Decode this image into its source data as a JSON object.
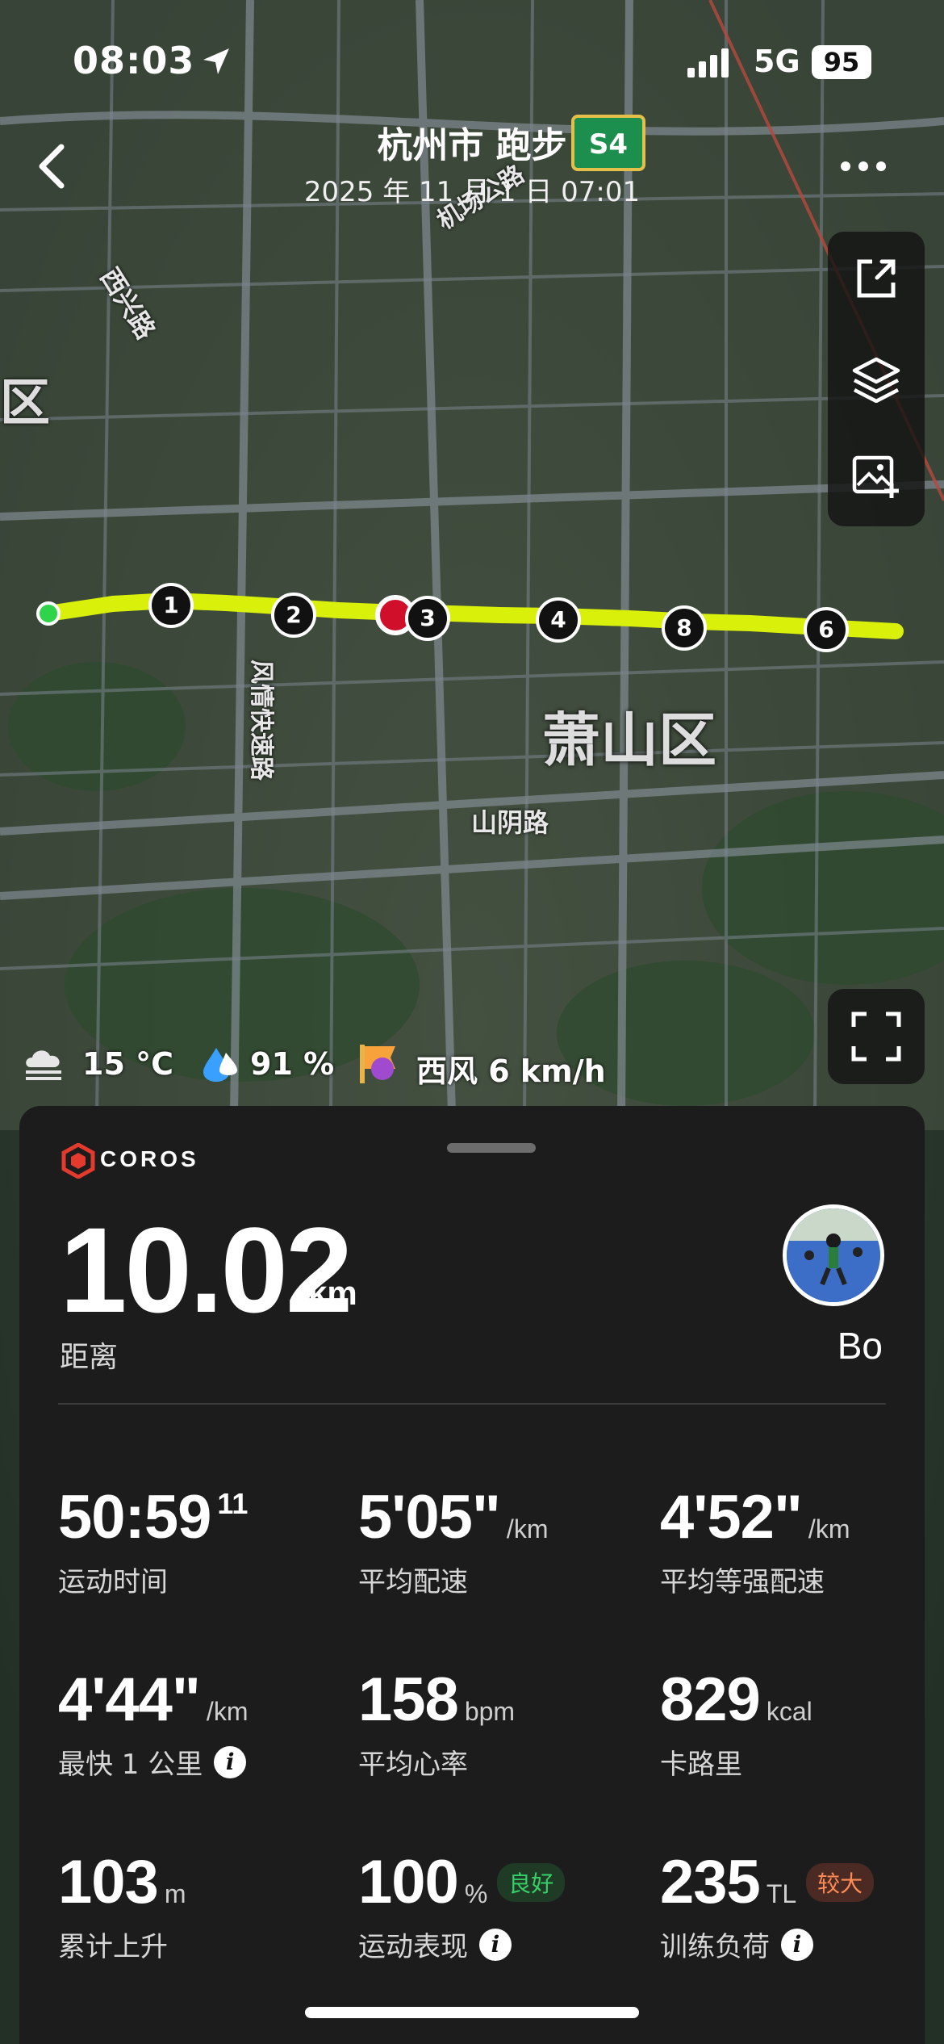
{
  "status_bar": {
    "time": "08:03",
    "network": "5G",
    "battery": "95"
  },
  "header": {
    "title": "杭州市 跑步",
    "subtitle": "2025 年 11 月 1 日 07:01"
  },
  "map": {
    "labels": {
      "district": "萧山区",
      "road_1": "西兴路",
      "road_2": "风情快速路",
      "road_3": "山阴路",
      "road_4": "机场公路",
      "district_partial": "区",
      "highway_shield": "S4"
    },
    "km_markers": [
      "1",
      "2",
      "3",
      "4",
      "8",
      "6"
    ],
    "route_color": "#d8f00a"
  },
  "weather": {
    "temperature": "15 °C",
    "humidity": "91 %",
    "wind": "西风 6 km/h"
  },
  "summary": {
    "brand": "COROS",
    "distance": "10.02",
    "distance_unit": "km",
    "distance_label": "距离",
    "user_name": "Bo",
    "stats": [
      {
        "value": "50:59",
        "unit": "11",
        "label": "运动时间"
      },
      {
        "value": "5'05\"",
        "unit": "/km",
        "label": "平均配速"
      },
      {
        "value": "4'52\"",
        "unit": "/km",
        "label": "平均等强配速"
      },
      {
        "value": "4'44\"",
        "unit": "/km",
        "label": "最快 1 公里"
      },
      {
        "value": "158",
        "unit": "bpm",
        "label": "平均心率"
      },
      {
        "value": "829",
        "unit": "kcal",
        "label": "卡路里"
      },
      {
        "value": "103",
        "unit": "m",
        "label": "累计上升"
      },
      {
        "value": "100",
        "unit": "%",
        "label": "运动表现",
        "badge": "良好"
      },
      {
        "value": "235",
        "unit": "TL",
        "label": "训练负荷",
        "badge": "较大"
      }
    ]
  }
}
